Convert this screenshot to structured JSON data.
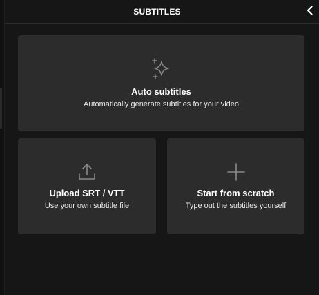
{
  "header": {
    "title": "SUBTITLES",
    "back_icon": "chevron-left-icon"
  },
  "options": {
    "auto": {
      "icon": "sparkles-icon",
      "title": "Auto subtitles",
      "description": "Automatically generate subtitles for your video"
    },
    "upload": {
      "icon": "upload-icon",
      "title": "Upload SRT / VTT",
      "description": "Use your own subtitle file"
    },
    "scratch": {
      "icon": "plus-icon",
      "title": "Start from scratch",
      "description": "Type out the subtitles yourself"
    }
  },
  "colors": {
    "background": "#161616",
    "card": "#2c2c2c",
    "icon": "#8a8a8a",
    "text": "#ffffff"
  }
}
